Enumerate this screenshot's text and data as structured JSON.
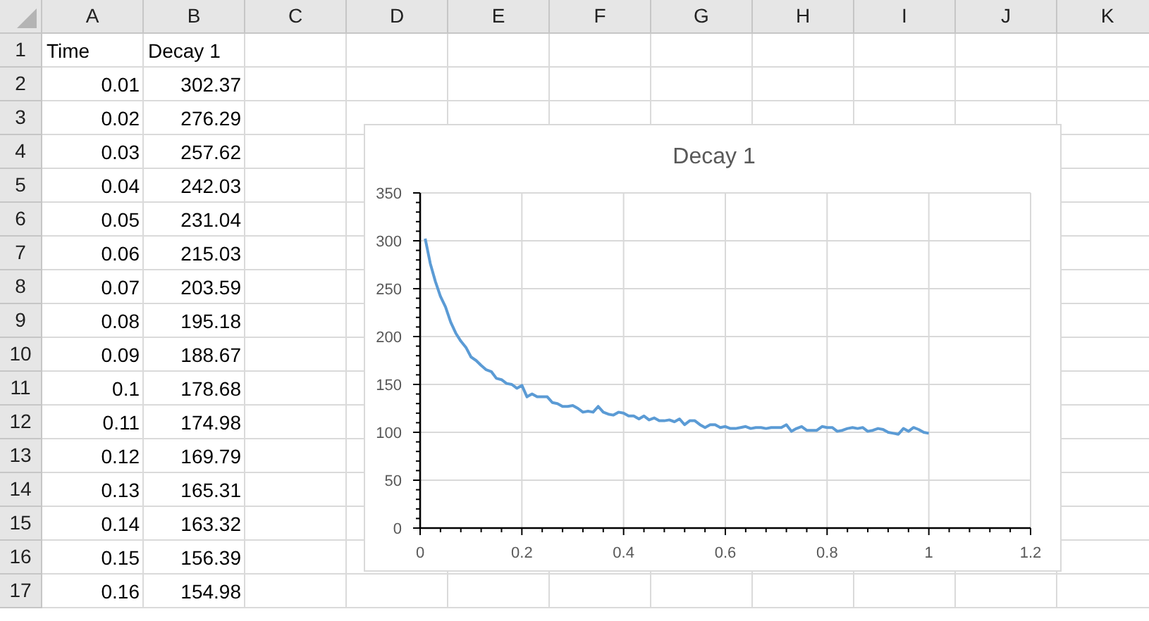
{
  "sheet": {
    "columns": [
      "A",
      "B",
      "C",
      "D",
      "E",
      "F",
      "G",
      "H",
      "I",
      "J",
      "K"
    ],
    "rows": [
      {
        "number": "1",
        "cells": [
          "Time",
          "Decay 1"
        ]
      },
      {
        "number": "2",
        "cells": [
          "0.01",
          "302.37"
        ]
      },
      {
        "number": "3",
        "cells": [
          "0.02",
          "276.29"
        ]
      },
      {
        "number": "4",
        "cells": [
          "0.03",
          "257.62"
        ]
      },
      {
        "number": "5",
        "cells": [
          "0.04",
          "242.03"
        ]
      },
      {
        "number": "6",
        "cells": [
          "0.05",
          "231.04"
        ]
      },
      {
        "number": "7",
        "cells": [
          "0.06",
          "215.03"
        ]
      },
      {
        "number": "8",
        "cells": [
          "0.07",
          "203.59"
        ]
      },
      {
        "number": "9",
        "cells": [
          "0.08",
          "195.18"
        ]
      },
      {
        "number": "10",
        "cells": [
          "0.09",
          "188.67"
        ]
      },
      {
        "number": "11",
        "cells": [
          "0.1",
          "178.68"
        ]
      },
      {
        "number": "12",
        "cells": [
          "0.11",
          "174.98"
        ]
      },
      {
        "number": "13",
        "cells": [
          "0.12",
          "169.79"
        ]
      },
      {
        "number": "14",
        "cells": [
          "0.13",
          "165.31"
        ]
      },
      {
        "number": "15",
        "cells": [
          "0.14",
          "163.32"
        ]
      },
      {
        "number": "16",
        "cells": [
          "0.15",
          "156.39"
        ]
      },
      {
        "number": "17",
        "cells": [
          "0.16",
          "154.98"
        ]
      }
    ]
  },
  "chart": {
    "chart_data": {
      "type": "line",
      "title": "Decay 1",
      "x": [
        0.01,
        0.02,
        0.03,
        0.04,
        0.05,
        0.06,
        0.07,
        0.08,
        0.09,
        0.1,
        0.11,
        0.12,
        0.13,
        0.14,
        0.15,
        0.16,
        0.17,
        0.18,
        0.19,
        0.2,
        0.21,
        0.22,
        0.23,
        0.24,
        0.25,
        0.26,
        0.27,
        0.28,
        0.29,
        0.3,
        0.31,
        0.32,
        0.33,
        0.34,
        0.35,
        0.36,
        0.37,
        0.38,
        0.39,
        0.4,
        0.41,
        0.42,
        0.43,
        0.44,
        0.45,
        0.46,
        0.47,
        0.48,
        0.49,
        0.5,
        0.51,
        0.52,
        0.53,
        0.54,
        0.55,
        0.56,
        0.57,
        0.58,
        0.59,
        0.6,
        0.61,
        0.62,
        0.63,
        0.64,
        0.65,
        0.66,
        0.67,
        0.68,
        0.69,
        0.7,
        0.71,
        0.72,
        0.73,
        0.74,
        0.75,
        0.76,
        0.77,
        0.78,
        0.79,
        0.8,
        0.81,
        0.82,
        0.83,
        0.84,
        0.85,
        0.86,
        0.87,
        0.88,
        0.89,
        0.9,
        0.91,
        0.92,
        0.93,
        0.94,
        0.95,
        0.96,
        0.97,
        0.98,
        0.99,
        1
      ],
      "grid": true,
      "series": [
        {
          "color": "#5b9bd5",
          "values": [
            302.37,
            276.29,
            257.62,
            242.03,
            231.04,
            215.03,
            203.59,
            195.18,
            188.67,
            178.68,
            174.98,
            169.79,
            165.31,
            163.32,
            156.39,
            154.98,
            151,
            150,
            146,
            149,
            137,
            140,
            137,
            137,
            137,
            131,
            130,
            127,
            127,
            128,
            125,
            121,
            122,
            121,
            127,
            121,
            119,
            118,
            121,
            120,
            117,
            117,
            114,
            117,
            113,
            115,
            112,
            112,
            113,
            111,
            114,
            108,
            112,
            112,
            108,
            105,
            108,
            108,
            105,
            106,
            104,
            104,
            105,
            106,
            104,
            105,
            105,
            104,
            105,
            105,
            105,
            108,
            101,
            104,
            106,
            102,
            102,
            102,
            106,
            105,
            105,
            101,
            102,
            104,
            105,
            104,
            105,
            101,
            102,
            104,
            103,
            100,
            99,
            98,
            104,
            101,
            105,
            103,
            100,
            99
          ]
        }
      ],
      "xlim": [
        0,
        1.2
      ],
      "ylim": [
        0,
        350
      ],
      "xticks": [
        0,
        {
          "value": 0.2,
          "label": "0.2"
        },
        {
          "value": 0.4,
          "label": "0.4"
        },
        {
          "value": 0.6,
          "label": "0.6"
        },
        {
          "value": 0.8,
          "label": "0.8"
        },
        1,
        {
          "value": 1.2,
          "label": "1.2"
        }
      ],
      "yticks": [
        0,
        50,
        100,
        150,
        200,
        250,
        300,
        350
      ]
    }
  }
}
